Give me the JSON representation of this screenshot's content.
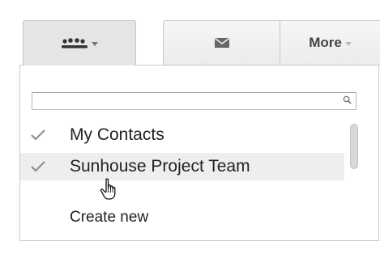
{
  "toolbar": {
    "groups_icon": "people-group-icon",
    "mail_icon": "envelope-icon",
    "more_label": "More"
  },
  "menu": {
    "search": {
      "value": "",
      "placeholder": "",
      "icon": "search-icon"
    },
    "items": [
      {
        "label": "My Contacts",
        "checked": true
      },
      {
        "label": "Sunhouse Project Team",
        "checked": true,
        "hovered": true
      }
    ],
    "create_new_label": "Create new"
  },
  "colors": {
    "active_button_bg": "#e5e5e5",
    "hover_row_bg": "#eeeeee",
    "checkmark": "#8f8f8f"
  }
}
